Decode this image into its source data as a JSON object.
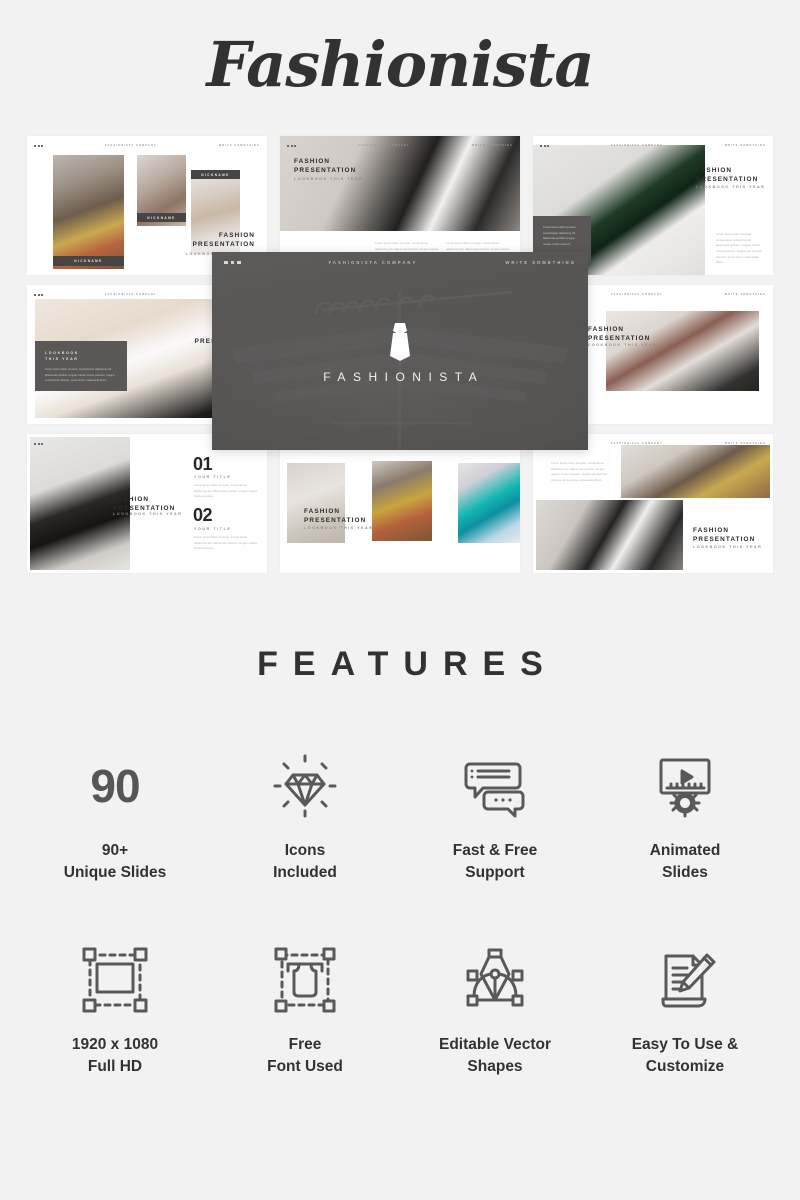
{
  "hero": {
    "title": "Fashionista"
  },
  "slide_chrome": {
    "company": "FASHIONISTA COMPANY",
    "write_something": "WRITE SOMETHING",
    "dots_count": 3
  },
  "common": {
    "headline_line1": "FASHION",
    "headline_line2": "PRESENTATION",
    "subhead": "LOOKBOOK THIS YEAR",
    "lookbook_line1": "LOOKBOOK",
    "lookbook_line2": "THIS YEAR",
    "nickname": "NICKNAME",
    "your_title": "YOUR TITLE",
    "lorem_short": "Lorem ipsum dolor sit amet, consectetuer adipiscing elit. Maecenas porttitor congue massa. Fusce posuere.",
    "lorem_long": "Lorem ipsum dolor sit amet, consectetuer adipiscing elit. Maecenas porttitor congue massa. Fusce posuere, magna sed pulvinar ultricies, purus lectus malesuada libero."
  },
  "slides": [
    {
      "id": "slide-1",
      "name": "three-portrait-intro"
    },
    {
      "id": "slide-2",
      "name": "leather-jacket-hero"
    },
    {
      "id": "slide-3",
      "name": "green-sneakers"
    },
    {
      "id": "slide-4",
      "name": "lookbook-panel"
    },
    {
      "id": "slide-5",
      "name": "seated-cardigan"
    },
    {
      "id": "slide-6",
      "name": "numbered-list"
    },
    {
      "id": "slide-7",
      "name": "triple-panel-gallery"
    },
    {
      "id": "slide-8",
      "name": "dual-portrait"
    }
  ],
  "overlay_slide": {
    "company": "FASHIONISTA COMPANY",
    "write_something": "WRITE SOMETHING",
    "brand": "FASHIONISTA"
  },
  "features_section": {
    "heading": "FEATURES",
    "items": [
      {
        "icon": "number-90",
        "number": "90",
        "label": "90+\nUnique Slides"
      },
      {
        "icon": "diamond-icon",
        "number": "",
        "label": "Icons\nIncluded"
      },
      {
        "icon": "chat-bubbles-icon",
        "number": "",
        "label": "Fast & Free\nSupport"
      },
      {
        "icon": "animated-video-icon",
        "number": "",
        "label": "Animated\nSlides"
      },
      {
        "icon": "resize-frame-icon",
        "number": "",
        "label": "1920 x 1080\nFull HD"
      },
      {
        "icon": "text-type-icon",
        "number": "",
        "label": "Free\nFont Used"
      },
      {
        "icon": "pen-tool-icon",
        "number": "",
        "label": "Editable Vector\nShapes"
      },
      {
        "icon": "document-pencil-icon",
        "number": "",
        "label": "Easy To Use &\nCustomize"
      }
    ]
  },
  "colors": {
    "background": "#f2f2f2",
    "ink": "#343231",
    "muted": "#8e8c8b",
    "overlay_dark": "#565452",
    "icon_stroke": "#5b5957",
    "slide_white": "#ffffff"
  }
}
